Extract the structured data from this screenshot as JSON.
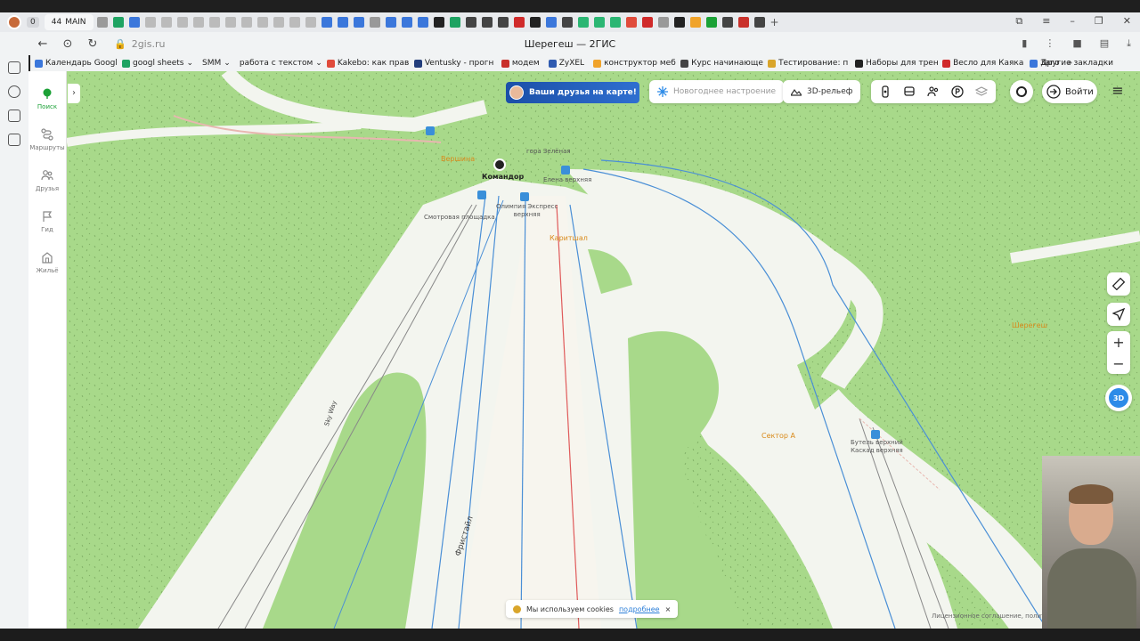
{
  "browser": {
    "tab_count": "0",
    "workspace_count": "44",
    "workspace_name": "MAIN",
    "url": "2gis.ru",
    "page_title": "Шерегеш — 2ГИС",
    "bookmarks": [
      {
        "label": "Календарь Googl",
        "color": "#3b77db"
      },
      {
        "label": "googl sheets",
        "color": "#1ea362"
      },
      {
        "label": "SMM",
        "color": "#888888"
      },
      {
        "label": "работа с текстом",
        "color": "#888888"
      },
      {
        "label": "Kakebo: как прав",
        "color": "#e04b3b"
      },
      {
        "label": "Ventusky - прогн",
        "color": "#233e7c"
      },
      {
        "label": "модем",
        "color": "#c9312b"
      },
      {
        "label": "ZyXEL",
        "color": "#2f5bb0"
      },
      {
        "label": "конструктор меб",
        "color": "#f0a32a"
      },
      {
        "label": "Курс начинающе",
        "color": "#444444"
      },
      {
        "label": "Тестирование: п",
        "color": "#d9a52b"
      },
      {
        "label": "Наборы для трен",
        "color": "#222222"
      },
      {
        "label": "Весло для Каяка",
        "color": "#d02a2a"
      },
      {
        "label": "Заго",
        "color": "#3b77db"
      }
    ],
    "other_bookmarks": "Другие закладки"
  },
  "sidebar": {
    "items": [
      {
        "label": "Поиск",
        "icon": "search-pin-icon",
        "active": true
      },
      {
        "label": "Маршруты",
        "icon": "route-icon"
      },
      {
        "label": "Друзья",
        "icon": "friends-icon"
      },
      {
        "label": "Гид",
        "icon": "flag-icon"
      },
      {
        "label": "Жильё",
        "icon": "housing-icon"
      }
    ]
  },
  "toolbar": {
    "promo_label": "Ваши друзья на карте!",
    "new_year_label": "Новогоднее настроение",
    "relief_label": "3D-рельеф",
    "login_label": "Войти",
    "btn_3d_label": "3D"
  },
  "map_labels": {
    "vershina": "Вершина",
    "gora_zelenaya": "гора Зелёная",
    "komandor": "Командор",
    "elena": "Елена верхняя",
    "smotrovaya": "Смотровая площадка",
    "olimpia_1": "Олимпия Экспресс",
    "olimpia_2": "верхняя",
    "karitshal": "Каритшал",
    "sheregesh": "Шерегеш",
    "sky_way": "Sky Way",
    "sektor_a": "Сектор А",
    "butel_1": "Бутель верхний",
    "butel_2": "Каскад верхняя",
    "fristail": "Фристайл"
  },
  "cookies": {
    "text": "Мы используем cookies",
    "more": "подробнее",
    "close": "×"
  },
  "license": "Лицензионное соглашение, политика ко",
  "colors": {
    "forest": "#a8d98a",
    "slope": "#f3f5ef",
    "accent_green": "#1ba136",
    "accent_blue": "#2d8be8"
  }
}
